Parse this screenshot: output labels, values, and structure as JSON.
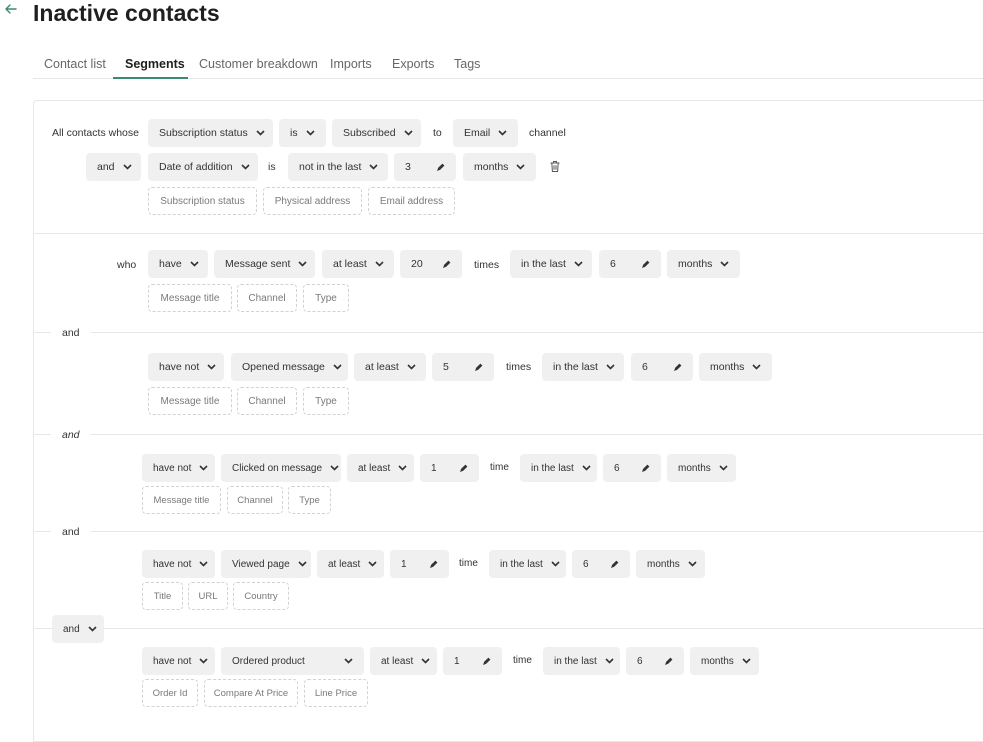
{
  "header": {
    "back_icon": "arrow-left-icon",
    "title": "Inactive contacts"
  },
  "tabs": [
    {
      "label": "Contact list",
      "active": false
    },
    {
      "label": "Segments",
      "active": true
    },
    {
      "label": "Customer breakdown",
      "active": false
    },
    {
      "label": "Imports",
      "active": false
    },
    {
      "label": "Exports",
      "active": false
    },
    {
      "label": "Tags",
      "active": false
    }
  ],
  "colors": {
    "accent": "#3a8a76",
    "pill_bg": "#f0f0f0",
    "border": "#e6e6e6"
  },
  "condition_group": {
    "prefix": "All contacts whose",
    "row1": {
      "field": "Subscription status",
      "operator": "is",
      "value": "Subscribed",
      "to": "to",
      "channel": "Email",
      "suffix": "channel"
    },
    "row2": {
      "conjunction": "and",
      "field": "Date of addition",
      "is": "is",
      "operator": "not in the last",
      "amount": "3",
      "unit": "months"
    },
    "suggestions": [
      "Subscription status",
      "Physical address",
      "Email address"
    ]
  },
  "behavior_rules": {
    "who_label": "who",
    "rules": [
      {
        "verb": "have",
        "event": "Message sent",
        "quantifier": "at least",
        "count": "20",
        "count_unit": "times",
        "period": "in the last",
        "period_amount": "6",
        "period_unit": "months",
        "filters": [
          "Message title",
          "Channel",
          "Type"
        ]
      },
      {
        "verb": "have not",
        "event": "Opened message",
        "quantifier": "at least",
        "count": "5",
        "count_unit": "times",
        "period": "in the last",
        "period_amount": "6",
        "period_unit": "months",
        "filters": [
          "Message title",
          "Channel",
          "Type"
        ]
      },
      {
        "verb": "have not",
        "event": "Clicked on message",
        "quantifier": "at least",
        "count": "1",
        "count_unit": "time",
        "period": "in the last",
        "period_amount": "6",
        "period_unit": "months",
        "filters": [
          "Message title",
          "Channel",
          "Type"
        ]
      },
      {
        "verb": "have not",
        "event": "Viewed page",
        "quantifier": "at least",
        "count": "1",
        "count_unit": "time",
        "period": "in the last",
        "period_amount": "6",
        "period_unit": "months",
        "filters": [
          "Title",
          "URL",
          "Country"
        ]
      },
      {
        "verb": "have not",
        "event": "Ordered product",
        "quantifier": "at least",
        "count": "1",
        "count_unit": "time",
        "period": "in the last",
        "period_amount": "6",
        "period_unit": "months",
        "filters": [
          "Order Id",
          "Compare At Price",
          "Line Price"
        ]
      }
    ],
    "connectors": [
      "and",
      "and",
      "and",
      "and"
    ]
  }
}
